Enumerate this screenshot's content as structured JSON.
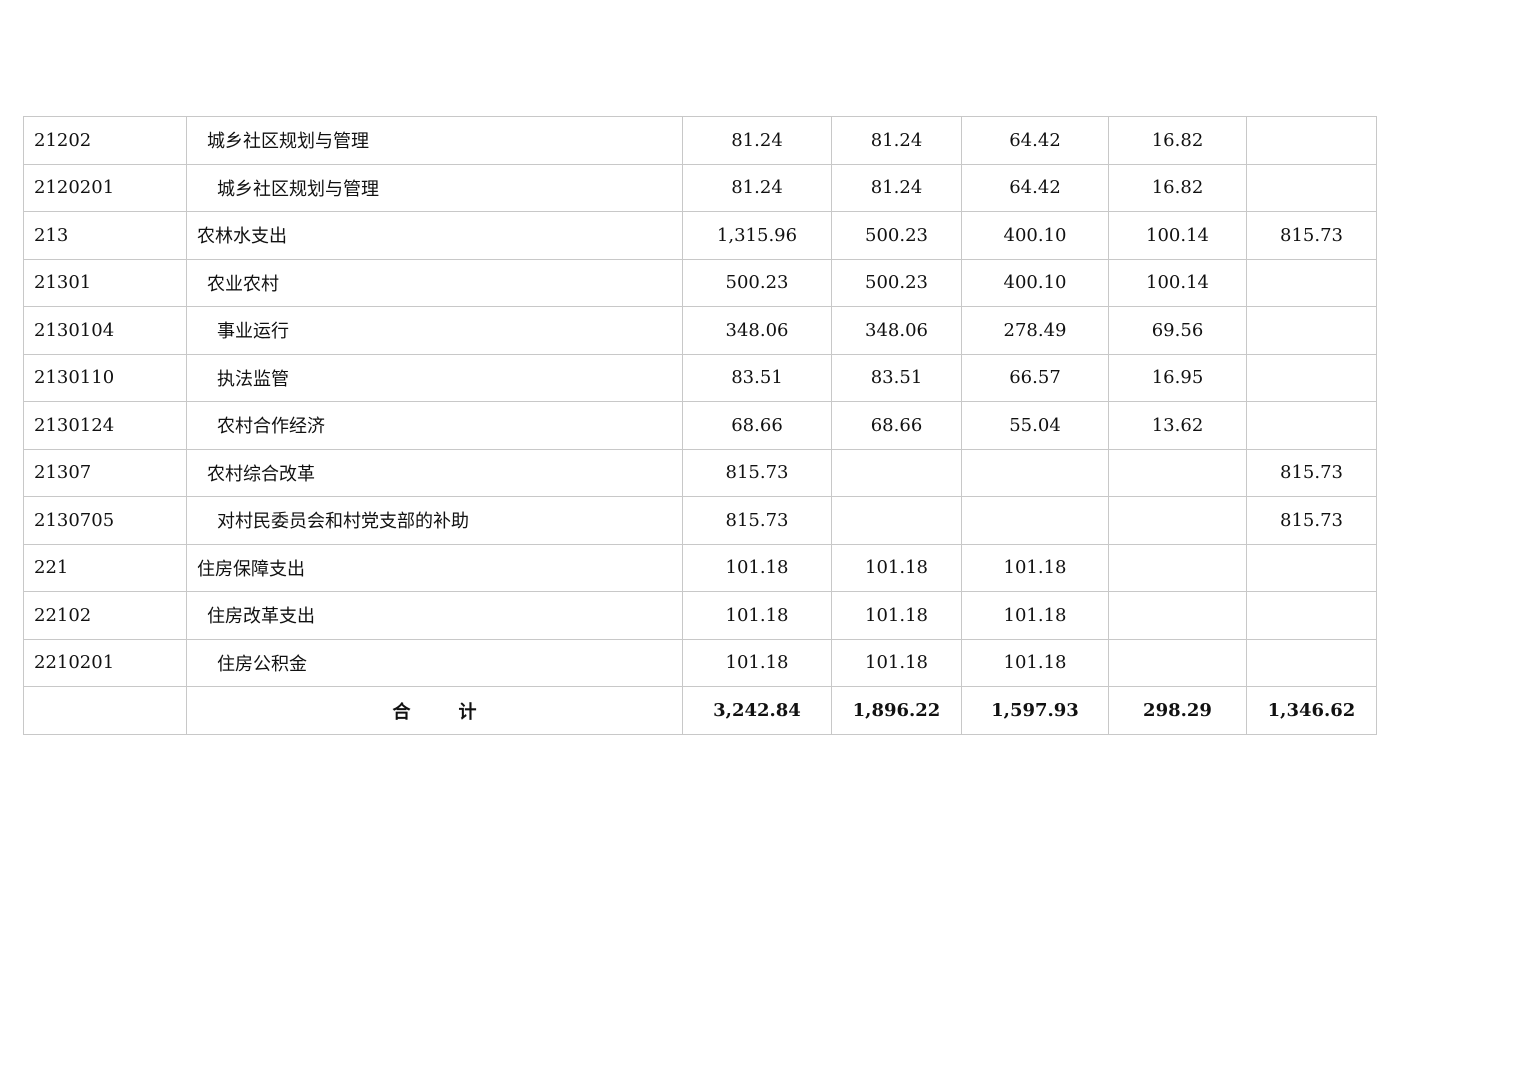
{
  "table": {
    "rows": [
      {
        "code": "21202",
        "name": "城乡社区规划与管理",
        "level": 1,
        "values": [
          "81.24",
          "81.24",
          "64.42",
          "16.82",
          ""
        ]
      },
      {
        "code": "2120201",
        "name": "城乡社区规划与管理",
        "level": 2,
        "values": [
          "81.24",
          "81.24",
          "64.42",
          "16.82",
          ""
        ]
      },
      {
        "code": "213",
        "name": "农林水支出",
        "level": 0,
        "values": [
          "1,315.96",
          "500.23",
          "400.10",
          "100.14",
          "815.73"
        ]
      },
      {
        "code": "21301",
        "name": "农业农村",
        "level": 1,
        "values": [
          "500.23",
          "500.23",
          "400.10",
          "100.14",
          ""
        ]
      },
      {
        "code": "2130104",
        "name": "事业运行",
        "level": 2,
        "values": [
          "348.06",
          "348.06",
          "278.49",
          "69.56",
          ""
        ]
      },
      {
        "code": "2130110",
        "name": "执法监管",
        "level": 2,
        "values": [
          "83.51",
          "83.51",
          "66.57",
          "16.95",
          ""
        ]
      },
      {
        "code": "2130124",
        "name": "农村合作经济",
        "level": 2,
        "values": [
          "68.66",
          "68.66",
          "55.04",
          "13.62",
          ""
        ]
      },
      {
        "code": "21307",
        "name": "农村综合改革",
        "level": 1,
        "values": [
          "815.73",
          "",
          "",
          "",
          "815.73"
        ]
      },
      {
        "code": "2130705",
        "name": "对村民委员会和村党支部的补助",
        "level": 2,
        "values": [
          "815.73",
          "",
          "",
          "",
          "815.73"
        ]
      },
      {
        "code": "221",
        "name": "住房保障支出",
        "level": 0,
        "values": [
          "101.18",
          "101.18",
          "101.18",
          "",
          ""
        ]
      },
      {
        "code": "22102",
        "name": "住房改革支出",
        "level": 1,
        "values": [
          "101.18",
          "101.18",
          "101.18",
          "",
          ""
        ]
      },
      {
        "code": "2210201",
        "name": "住房公积金",
        "level": 2,
        "values": [
          "101.18",
          "101.18",
          "101.18",
          "",
          ""
        ]
      }
    ],
    "total": {
      "label_1": "合",
      "label_2": "计",
      "values": [
        "3,242.84",
        "1,896.22",
        "1,597.93",
        "298.29",
        "1,346.62"
      ]
    }
  }
}
